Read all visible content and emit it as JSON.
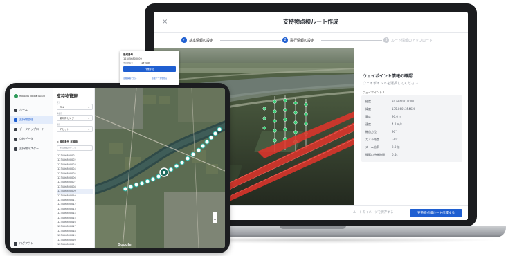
{
  "laptop": {
    "title": "支持物点検ルート作成",
    "close_glyph": "×",
    "steps": [
      {
        "num": "✓",
        "label": "基本情報の設定",
        "state": "done"
      },
      {
        "num": "2",
        "label": "飛行情報の設定",
        "state": "current"
      },
      {
        "num": "3",
        "label": "ルート情報のアップロード",
        "state": "pending"
      }
    ],
    "panel": {
      "title": "ウェイポイント情報の確認",
      "subtitle": "ウェイポイントを選択してください",
      "tag": "ウェイポイント 1",
      "rows": [
        {
          "key": "経度",
          "value": "34.6860814000"
        },
        {
          "key": "緯度",
          "value": "135.8601354620"
        },
        {
          "key": "高度",
          "value": "90.0 m"
        },
        {
          "key": "速度",
          "value": "4.2 m/s"
        },
        {
          "key": "機首方位",
          "value": "90°"
        },
        {
          "key": "カメラ角度",
          "value": "-30°"
        },
        {
          "key": "ズーム倍率",
          "value": "2.0 倍"
        },
        {
          "key": "撮影の待機時間",
          "value": "0.5s"
        }
      ]
    },
    "footer": {
      "ghost_label": "ルートのイメージを保存する",
      "primary_label": "支持物点検ルート作成する"
    },
    "accent": "#1f5fd1"
  },
  "tablet": {
    "brand": "HANSHIN DRONE CLOUD",
    "nav": [
      {
        "label": "ホーム",
        "active": false
      },
      {
        "label": "支持物管理",
        "active": true
      },
      {
        "label": "データアップロード",
        "active": false
      },
      {
        "label": "点検データ",
        "active": false
      },
      {
        "label": "支持物マスター",
        "active": false
      }
    ],
    "logout": "ログアウト",
    "page_title": "支持物管理",
    "filters": [
      {
        "label": "区分",
        "value": "TRL"
      },
      {
        "label": "事業所",
        "value": "新河岸センター"
      },
      {
        "label": "種別",
        "value": "アセット"
      }
    ],
    "list_header": "< 鉄塔番号 昇順順",
    "search_placeholder": "支持物番号を入力",
    "items": [
      "123456800001",
      "123456800002",
      "123456800003",
      "123456800004",
      "123456800005",
      "123456800006",
      "123456800007",
      "123456800008",
      "123456800009",
      "123456800010",
      "123456800011",
      "123456800012",
      "123456800013",
      "123456800014",
      "123456800015",
      "123456800016",
      "123456800017",
      "123456800018",
      "123456800019",
      "123456800020",
      "123456800021"
    ],
    "selected_index": 8,
    "popup": {
      "title": "鉄塔番号",
      "id": "123456800009",
      "key": "支持物番号",
      "value": "123号鉄塔",
      "primary": "作業する",
      "link1": "点検情報を見る",
      "link2": "点検データを見る"
    },
    "map_watermark": "Google",
    "zoom_plus": "+",
    "zoom_minus": "−"
  }
}
